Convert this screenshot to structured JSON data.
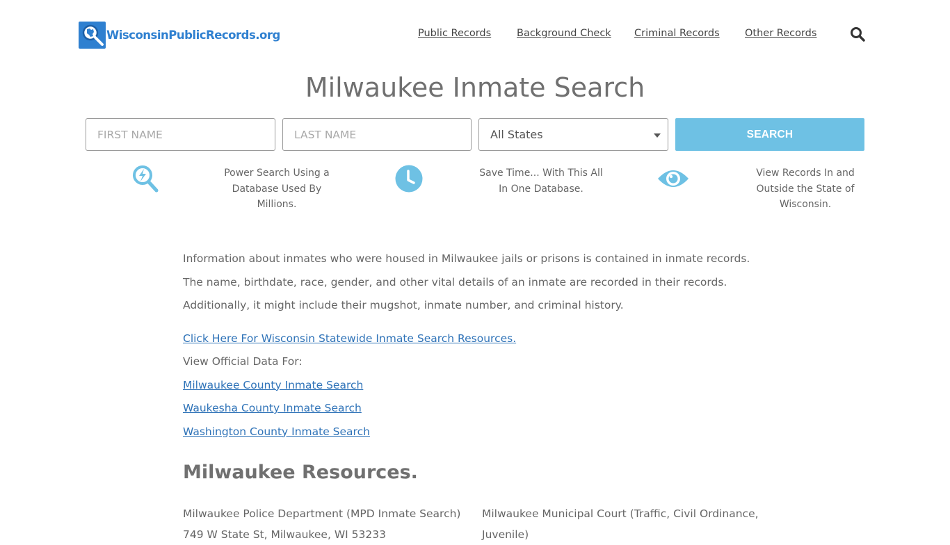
{
  "header": {
    "logo_text": "WisconsinPublicRecords.org",
    "nav": [
      {
        "label": "Public Records"
      },
      {
        "label": "Background Check"
      },
      {
        "label": "Criminal Records"
      },
      {
        "label": "Other Records"
      }
    ]
  },
  "page": {
    "title": "Milwaukee Inmate Search"
  },
  "search": {
    "first_name_placeholder": "FIRST NAME",
    "last_name_placeholder": "LAST NAME",
    "state_selected": "All States",
    "button_label": "SEARCH"
  },
  "features": [
    {
      "icon": "power-search-icon",
      "text": "Power Search Using a Database Used By Millions."
    },
    {
      "icon": "clock-icon",
      "text": "Save Time... With This All In One Database."
    },
    {
      "icon": "eye-icon",
      "text": "View Records In and Outside the State of Wisconsin."
    }
  ],
  "content": {
    "intro": "Information about inmates who were housed in Milwaukee jails or prisons is contained in inmate records. The name, birthdate, race, gender, and other vital details of an inmate are recorded in their records. Additionally, it might include their mugshot, inmate number, and criminal history.",
    "statewide_link": "Click Here For Wisconsin Statewide Inmate Search Resources.",
    "official_label": "View Official Data For:",
    "county_links": [
      "Milwaukee County Inmate Search",
      "Waukesha County Inmate Search",
      "Washington County Inmate Search"
    ]
  },
  "resources": {
    "heading": "Milwaukee Resources.",
    "items": [
      {
        "line1": "Milwaukee Police Department (MPD Inmate Search)",
        "line2": "749 W State St, Milwaukee, WI 53233"
      },
      {
        "line1": "Milwaukee Municipal Court (Traffic, Civil Ordinance,",
        "line2": "Juvenile)"
      }
    ]
  },
  "colors": {
    "brand_blue": "#2f80d0",
    "button_blue": "#6ec1e4",
    "icon_blue": "#6ec1e4",
    "link_blue": "#2f73b8"
  }
}
